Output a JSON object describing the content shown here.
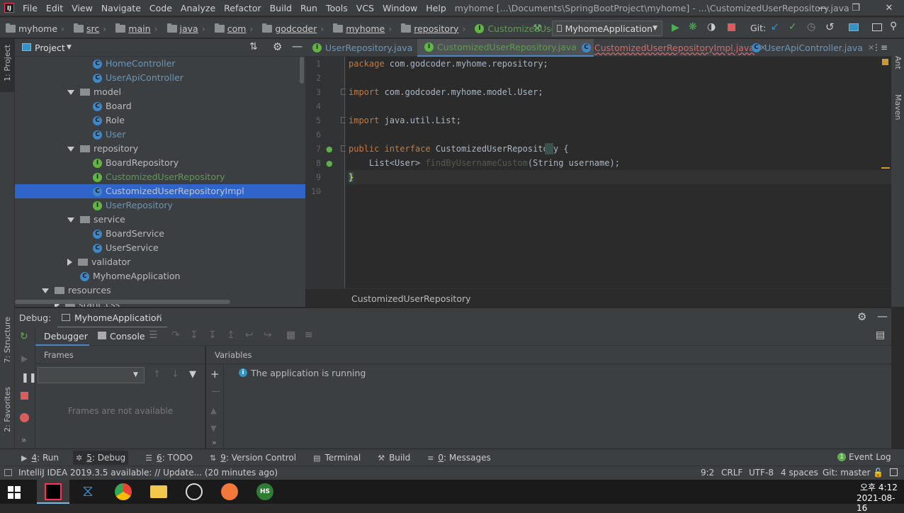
{
  "titlebar": {
    "logo": "IJ",
    "menu": [
      "File",
      "Edit",
      "View",
      "Navigate",
      "Code",
      "Analyze",
      "Refactor",
      "Build",
      "Run",
      "Tools",
      "VCS",
      "Window",
      "Help"
    ],
    "title": "myhome [...\\Documents\\SpringBootProject\\myhome] - ...\\CustomizedUserRepository.java"
  },
  "navbar": {
    "crumbs": [
      "myhome",
      "src",
      "main",
      "java",
      "com",
      "godcoder",
      "myhome",
      "repository",
      "CustomizedUserRepository"
    ],
    "run_config": "MyhomeApplication",
    "git_label": "Git:"
  },
  "project": {
    "header": "Project",
    "tree": [
      {
        "label": "HomeController",
        "icon": "class",
        "indent": 5,
        "color": "#6897bb"
      },
      {
        "label": "UserApiController",
        "icon": "class",
        "indent": 5,
        "color": "#6897bb"
      },
      {
        "label": "model",
        "icon": "folder",
        "indent": 4,
        "expanded": true,
        "color": "#bbbbbb"
      },
      {
        "label": "Board",
        "icon": "class",
        "indent": 5,
        "color": "#bbbbbb"
      },
      {
        "label": "Role",
        "icon": "class",
        "indent": 5,
        "color": "#bbbbbb"
      },
      {
        "label": "User",
        "icon": "class",
        "indent": 5,
        "color": "#6897bb"
      },
      {
        "label": "repository",
        "icon": "folder",
        "indent": 4,
        "expanded": true,
        "color": "#bbbbbb"
      },
      {
        "label": "BoardRepository",
        "icon": "interface",
        "indent": 5,
        "color": "#bbbbbb"
      },
      {
        "label": "CustomizedUserRepository",
        "icon": "interface",
        "indent": 5,
        "color": "#629755"
      },
      {
        "label": "CustomizedUserRepositoryImpl",
        "icon": "class",
        "indent": 5,
        "color": "#c4c4c4",
        "selected": true
      },
      {
        "label": "UserRepository",
        "icon": "interface",
        "indent": 5,
        "color": "#6897bb"
      },
      {
        "label": "service",
        "icon": "folder",
        "indent": 4,
        "expanded": true,
        "color": "#bbbbbb"
      },
      {
        "label": "BoardService",
        "icon": "class",
        "indent": 5,
        "color": "#bbbbbb"
      },
      {
        "label": "UserService",
        "icon": "class",
        "indent": 5,
        "color": "#bbbbbb"
      },
      {
        "label": "validator",
        "icon": "folder",
        "indent": 4,
        "expanded": false,
        "color": "#bbbbbb"
      },
      {
        "label": "MyhomeApplication",
        "icon": "class",
        "indent": 4,
        "color": "#bbbbbb"
      },
      {
        "label": "resources",
        "icon": "folder",
        "indent": 2,
        "expanded": true,
        "color": "#bbbbbb"
      },
      {
        "label": "static.css",
        "icon": "folder",
        "indent": 3,
        "expanded": false,
        "color": "#bbbbbb"
      }
    ]
  },
  "editor": {
    "tabs": [
      {
        "label": "UserRepository.java",
        "icon": "interface",
        "color": "#6897bb",
        "active": false
      },
      {
        "label": "CustomizedUserRepository.java",
        "icon": "interface",
        "color": "#629755",
        "active": true
      },
      {
        "label": "CustomizedUserRepositoryImpl.java",
        "icon": "class",
        "color": "#d16b6b",
        "active": false
      },
      {
        "label": "UserApiController.java",
        "icon": "class",
        "color": "#6897bb",
        "active": false
      }
    ],
    "more_tabs": "⋮≡",
    "line_numbers": [
      "1",
      "2",
      "3",
      "4",
      "5",
      "6",
      "7",
      "8",
      "9",
      "10"
    ],
    "lines": [
      {
        "kw": "package",
        "rest": " com.godcoder.myhome.repository;"
      },
      {
        "kw": "",
        "rest": ""
      },
      {
        "kw": "import",
        "rest": " com.godcoder.myhome.model.User;"
      },
      {
        "kw": "",
        "rest": ""
      },
      {
        "kw": "import",
        "rest": " java.util.List;"
      },
      {
        "kw": "",
        "rest": ""
      },
      {
        "kw": "public interface",
        "rest": " CustomizedUserRepository {"
      },
      {
        "kw": "",
        "rest": "    List<User> ",
        "fn": "findByUsernameCustom",
        "tail": "(String username);"
      },
      {
        "kw": "",
        "rest": "}"
      },
      {
        "kw": "",
        "rest": ""
      }
    ],
    "breadcrumb": "CustomizedUserRepository"
  },
  "debug": {
    "label": "Debug:",
    "session": "MyhomeApplication",
    "tabs": [
      "Debugger",
      "Console"
    ],
    "frames_header": "Frames",
    "frames_empty": "Frames are not available",
    "variables_header": "Variables",
    "running_msg": "The application is running"
  },
  "toolwindows": [
    {
      "num": "4",
      "label": ": Run"
    },
    {
      "num": "5",
      "label": ": Debug"
    },
    {
      "num": "6",
      "label": ": TODO"
    },
    {
      "num": "9",
      "label": ": Version Control"
    },
    {
      "num": "",
      "label": "Terminal"
    },
    {
      "num": "",
      "label": "Build"
    },
    {
      "num": "0",
      "label": ": Messages"
    }
  ],
  "event_log": "Event Log",
  "status": {
    "message": "IntelliJ IDEA 2019.3.5 available: // Update... (20 minutes ago)",
    "position": "9:2",
    "line_sep": "CRLF",
    "encoding": "UTF-8",
    "indent": "4 spaces",
    "git": "Git: master"
  },
  "stripes": {
    "project": "1: Project",
    "structure": "7: Structure",
    "favorites": "2: Favorites",
    "ant": "Ant",
    "maven": "Maven"
  },
  "taskbar": {
    "time": "오후 4:12",
    "date": "2021-08-16",
    "hs": "HS"
  }
}
